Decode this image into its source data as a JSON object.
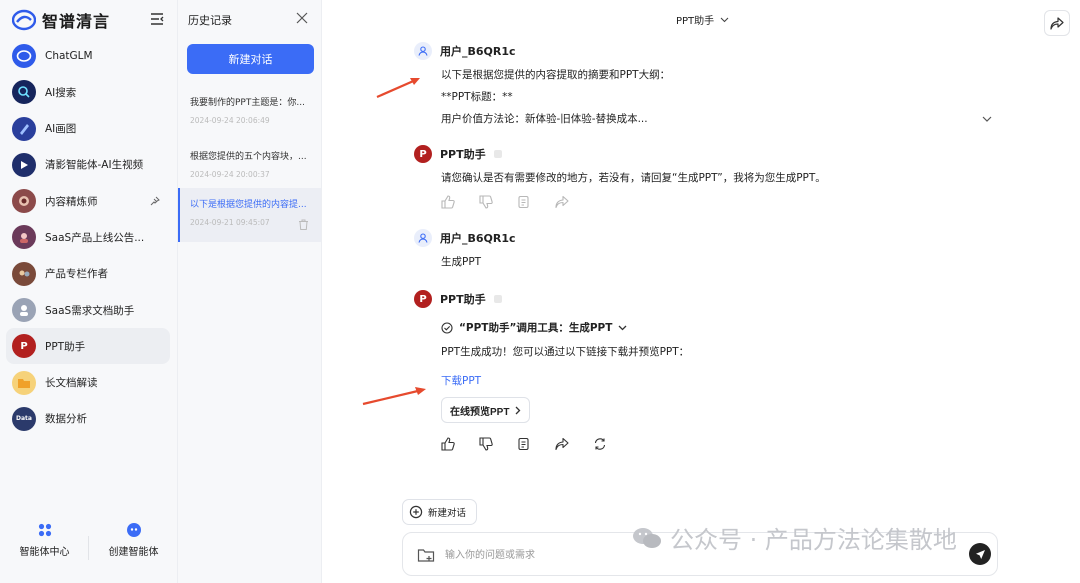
{
  "brand": {
    "name": "智谱清言"
  },
  "nav": {
    "items": [
      {
        "label": "ChatGLM",
        "color": "#2f5bea"
      },
      {
        "label": "AI搜索",
        "color": "#16255c"
      },
      {
        "label": "AI画图",
        "color": "#2a3f9c"
      },
      {
        "label": "清影智能体-AI生视频",
        "color": "#1f2e6b"
      },
      {
        "label": "内容精炼师",
        "color": "#8c4a4a"
      },
      {
        "label": "SaaS产品上线公告...",
        "color": "#6b3a5a"
      },
      {
        "label": "产品专栏作者",
        "color": "#7a4a3a"
      },
      {
        "label": "SaaS需求文档助手",
        "color": "#9aa3b5"
      },
      {
        "label": "PPT助手",
        "color": "#b2201f",
        "glyph": "P"
      },
      {
        "label": "长文档解读",
        "color": "#f0b73a"
      },
      {
        "label": "数据分析",
        "color": "#2b3a6b",
        "glyph": "Data"
      }
    ],
    "bottom": [
      {
        "label": "智能体中心"
      },
      {
        "label": "创建智能体"
      }
    ]
  },
  "history": {
    "title": "历史记录",
    "new_chat_label": "新建对话",
    "items": [
      {
        "text": "我要制作的PPT主题是：你...",
        "time": "2024-09-24 20:06:49"
      },
      {
        "text": "根据您提供的五个内容块，...",
        "time": "2024-09-24 20:00:37"
      },
      {
        "text": "以下是根据您提供的内容提...",
        "time": "2024-09-21 09:45:07"
      }
    ]
  },
  "main": {
    "assistant_title": "PPT助手",
    "messages": {
      "m1": {
        "sender": "用户_B6QR1c",
        "lines": [
          "以下是根据您提供的内容提取的摘要和PPT大纲：",
          "**PPT标题：**",
          "用户价值方法论：新体验-旧体验-替换成本..."
        ]
      },
      "m2": {
        "sender": "PPT助手",
        "lines": [
          "请您确认是否有需要修改的地方，若没有，请回复“生成PPT”，我将为您生成PPT。"
        ]
      },
      "m3": {
        "sender": "用户_B6QR1c",
        "lines": [
          "生成PPT"
        ]
      },
      "m4": {
        "sender": "PPT助手",
        "tool": "“PPT助手”调用工具：生成PPT",
        "line": "PPT生成成功！您可以通过以下链接下载并预览PPT：",
        "link": "下载PPT",
        "preview": "在线预览PPT"
      }
    },
    "new_conv_label": "新建对话",
    "input_placeholder": "输入你的问题或需求"
  },
  "watermark": "公众号 · 产品方法论集散地",
  "colors": {
    "accent": "#3b6cf6",
    "arrow": "#e64a2e",
    "ppt": "#b2201f"
  }
}
